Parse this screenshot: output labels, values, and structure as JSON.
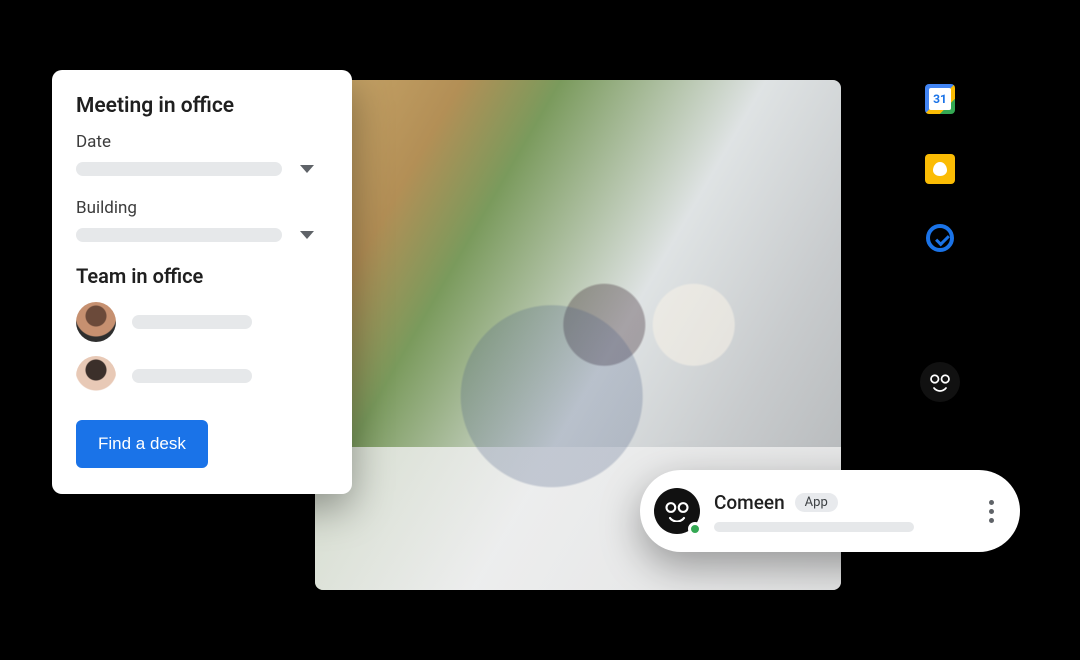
{
  "card": {
    "title": "Meeting in office",
    "date_label": "Date",
    "building_label": "Building",
    "team_title": "Team in office",
    "cta": "Find a desk"
  },
  "sidebar": {
    "calendar_day": "31",
    "icons": [
      "calendar-icon",
      "keep-icon",
      "tasks-icon",
      "contacts-icon",
      "comeen-icon"
    ]
  },
  "pill": {
    "name": "Comeen",
    "badge": "App",
    "status_color": "#34A853"
  }
}
